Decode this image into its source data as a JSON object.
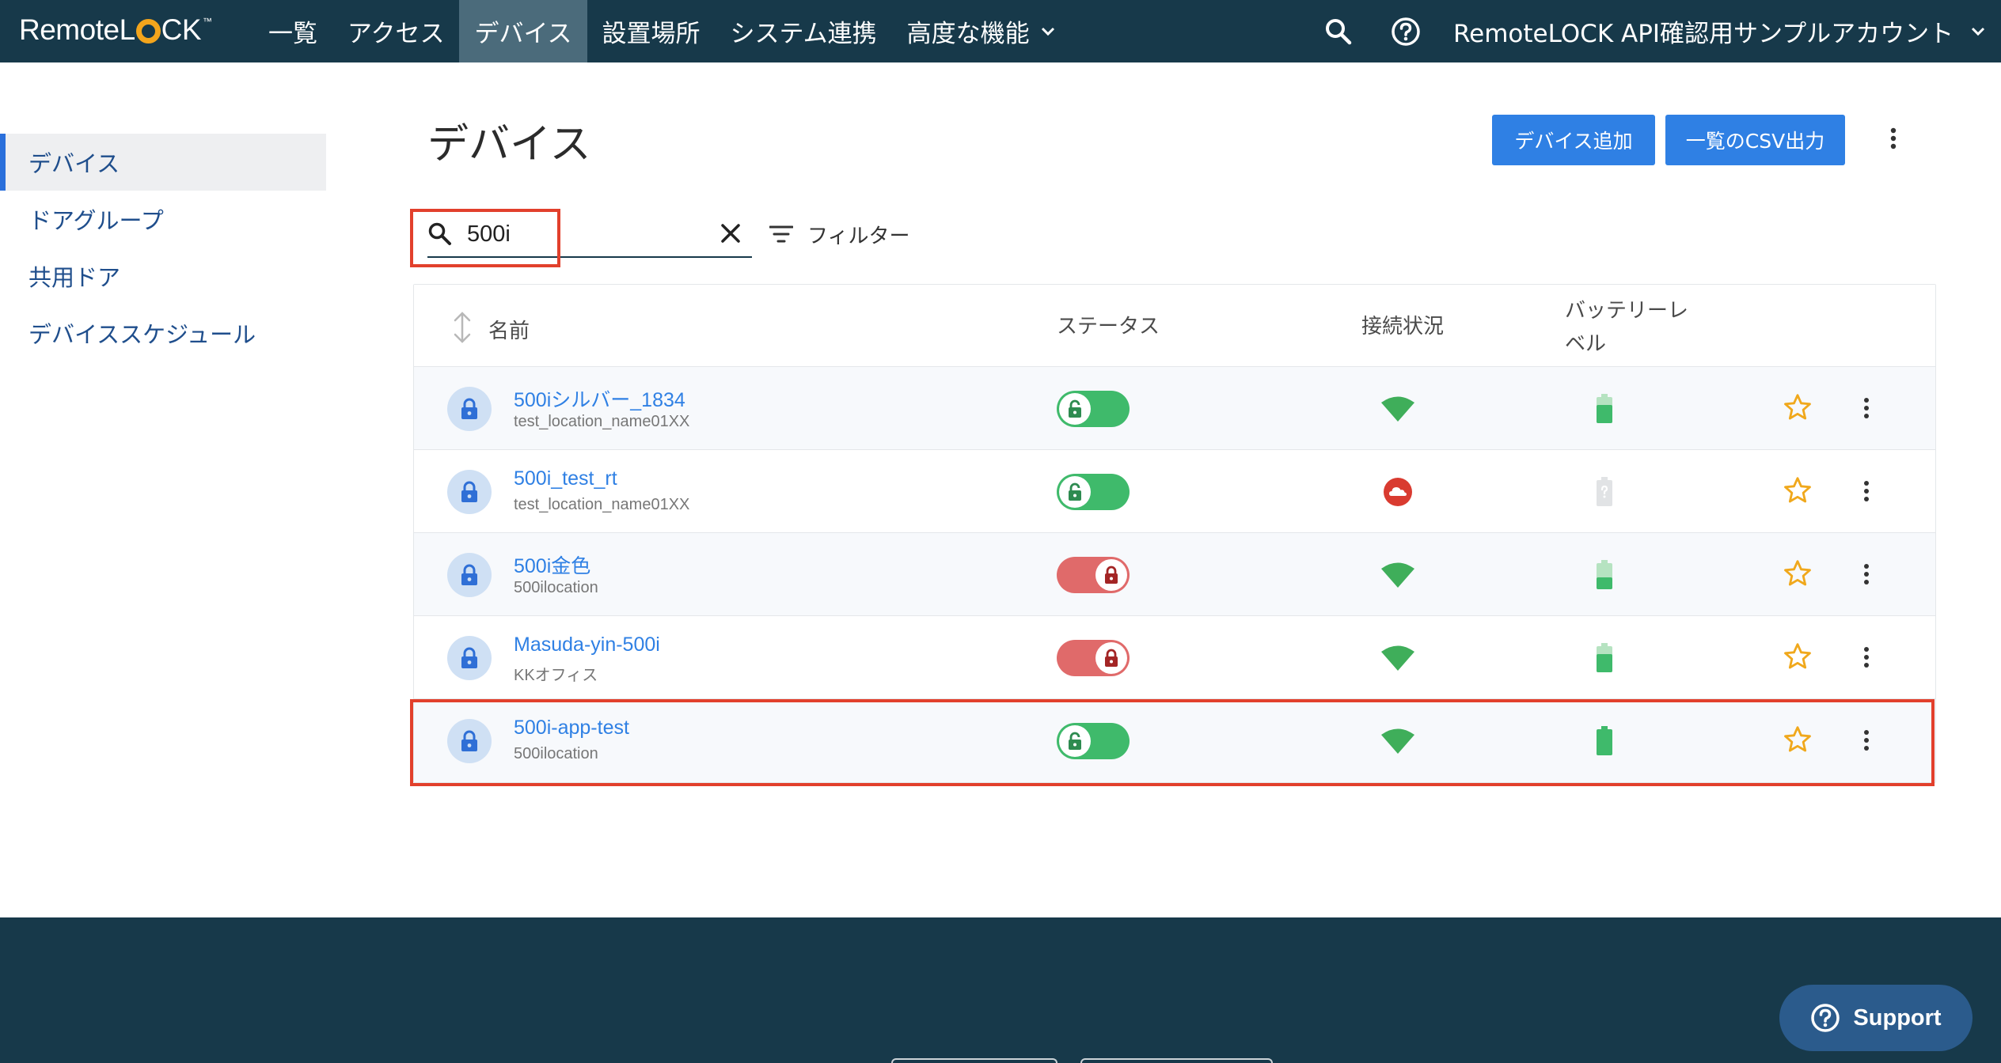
{
  "brand": {
    "left": "Remote",
    "l": "L",
    "right": "CK",
    "tm": "™"
  },
  "nav": {
    "items": [
      {
        "label": "一覧"
      },
      {
        "label": "アクセス"
      },
      {
        "label": "デバイス",
        "active": true
      },
      {
        "label": "設置場所"
      },
      {
        "label": "システム連携"
      },
      {
        "label": "高度な機能",
        "dropdown": true
      }
    ],
    "account": "RemoteLOCK API確認用サンプルアカウント"
  },
  "sidebar": {
    "items": [
      {
        "label": "デバイス",
        "active": true
      },
      {
        "label": "ドアグループ"
      },
      {
        "label": "共用ドア"
      },
      {
        "label": "デバイススケジュール"
      }
    ]
  },
  "page": {
    "title": "デバイス",
    "add_button": "デバイス追加",
    "csv_button": "一覧のCSV出力"
  },
  "search": {
    "value": "500i",
    "filter_label": "フィルター"
  },
  "table": {
    "headers": {
      "name": "名前",
      "status": "ステータス",
      "connection": "接続状況",
      "battery_line1": "バッテリーレ",
      "battery_line2": "ベル"
    },
    "rows": [
      {
        "name": "500iシルバー_1834",
        "location": "test_location_name01XX",
        "status": "unlocked",
        "connection": "online",
        "battery": "medium"
      },
      {
        "name": "500i_test_rt",
        "location": "test_location_name01XX",
        "status": "unlocked",
        "connection": "offline",
        "battery": "unknown"
      },
      {
        "name": "500i金色",
        "location": "500ilocation",
        "status": "locked",
        "connection": "online",
        "battery": "low"
      },
      {
        "name": "Masuda-yin-500i",
        "location": "KKオフィス",
        "status": "locked",
        "connection": "online",
        "battery": "medium"
      },
      {
        "name": "500i-app-test",
        "location": "500ilocation",
        "status": "unlocked",
        "connection": "online",
        "battery": "full"
      }
    ]
  },
  "colors": {
    "topbar": "#17394a",
    "accent": "#2f80e4",
    "unlocked": "#3fba6b",
    "locked": "#e06a6a",
    "offline": "#d93b30",
    "star": "#f0a81c",
    "highlight": "#e2402c"
  },
  "support": {
    "label": "Support"
  }
}
